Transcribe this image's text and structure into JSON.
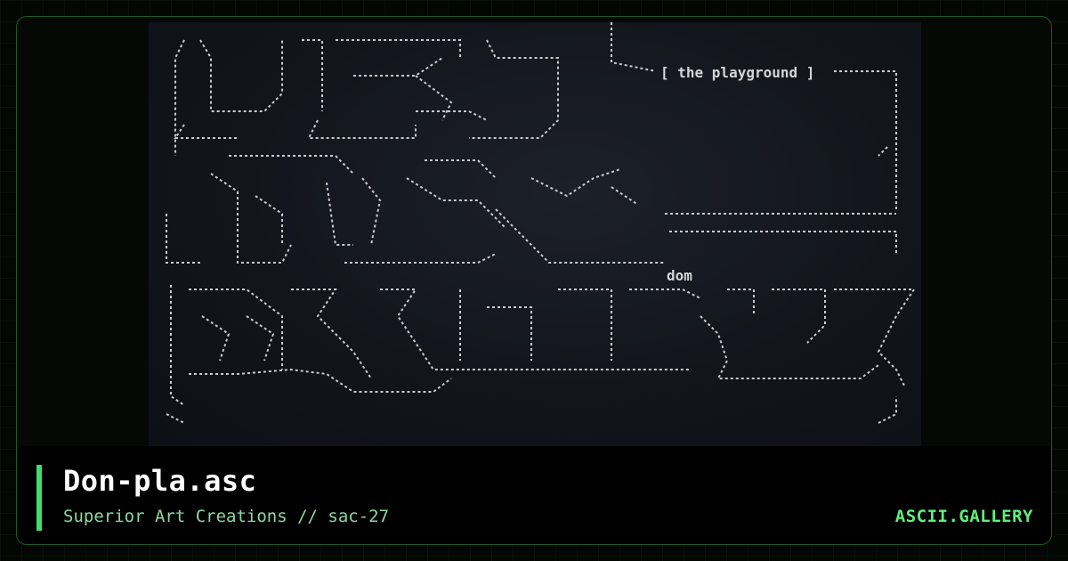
{
  "art": {
    "caption": "[ the playground ]",
    "signature": "dom"
  },
  "footer": {
    "title": "Don-pla.asc",
    "subtitle": "Superior Art Creations // sac-27",
    "brand": "ASCII.GALLERY"
  },
  "colors": {
    "accent": "#3ee06a",
    "brand": "#5ef07c",
    "subtitle": "#8ed9a0",
    "frame": "#1e5a26",
    "art_text": "#d4d6da"
  }
}
